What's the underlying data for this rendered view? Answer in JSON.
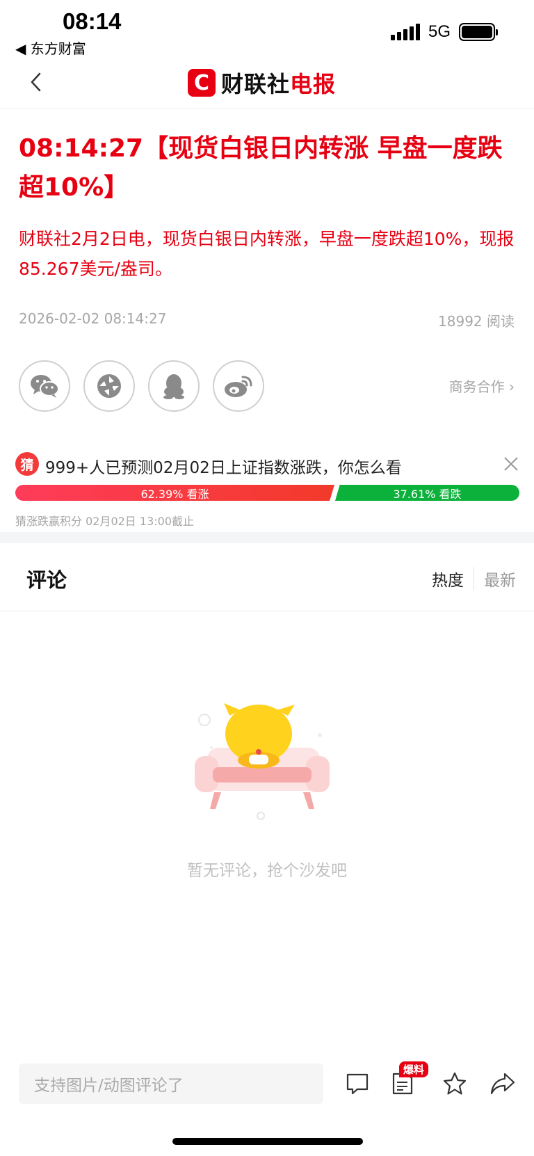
{
  "status_bar": {
    "time": "08:14",
    "back_app": "◀ 东方财富",
    "network": "5G"
  },
  "nav": {
    "logo_mark": "C",
    "logo_text_black": "财联社",
    "logo_text_red": "电报"
  },
  "article": {
    "headline": "08:14:27【现货白银日内转涨  早盘一度跌超10%】",
    "body": "财联社2月2日电，现货白银日内转涨，早盘一度跌超10%，现报85.267美元/盎司。",
    "date": "2026-02-02 08:14:27",
    "reads": "18992 阅读"
  },
  "share": {
    "items": [
      "wechat-icon",
      "moments-icon",
      "qq-icon",
      "weibo-icon"
    ],
    "biz_link": "商务合作 ›"
  },
  "prediction": {
    "badge": "猜",
    "question": "999+人已预测02月02日上证指数涨跌，你怎么看",
    "up_label": "62.39% 看涨",
    "down_label": "37.61% 看跌",
    "up_percent": 62.39,
    "down_percent": 37.61,
    "footer": "猜涨跌赢积分   02月02日 13:00截止"
  },
  "comments": {
    "title": "评论",
    "sort_hot": "热度",
    "sort_new": "最新",
    "empty_text": "暂无评论，抢个沙发吧"
  },
  "bottom_bar": {
    "input_placeholder": "支持图片/动图评论了",
    "tip_badge": "爆料"
  },
  "colors": {
    "brand_red": "#e60012",
    "up_red": "#f23a2a",
    "down_green": "#0bb13a"
  }
}
